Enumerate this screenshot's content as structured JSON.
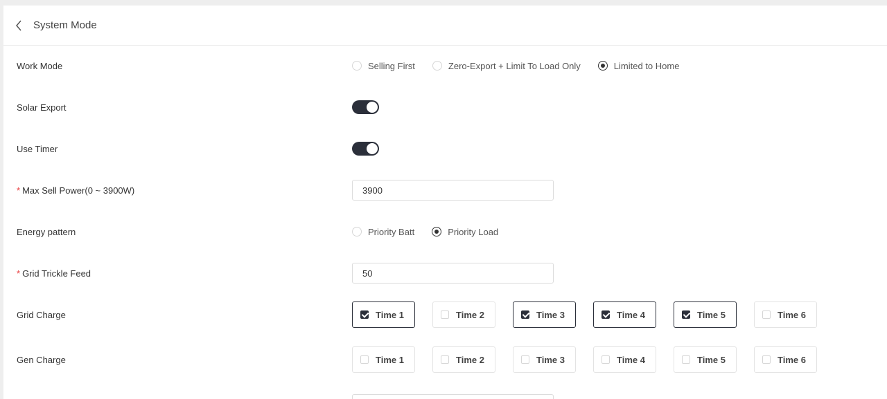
{
  "header": {
    "title": "System Mode"
  },
  "work_mode": {
    "label": "Work Mode",
    "options": [
      {
        "label": "Selling First",
        "selected": false
      },
      {
        "label": "Zero-Export + Limit To Load Only",
        "selected": false
      },
      {
        "label": "Limited to Home",
        "selected": true
      }
    ]
  },
  "solar_export": {
    "label": "Solar Export",
    "on": true
  },
  "use_timer": {
    "label": "Use Timer",
    "on": true
  },
  "max_sell_power": {
    "required_mark": "*",
    "label": "Max Sell Power(0 ~ 3900W)",
    "value": "3900"
  },
  "energy_pattern": {
    "label": "Energy pattern",
    "options": [
      {
        "label": "Priority Batt",
        "selected": false
      },
      {
        "label": "Priority Load",
        "selected": true
      }
    ]
  },
  "grid_trickle_feed": {
    "required_mark": "*",
    "label": "Grid Trickle Feed",
    "value": "50"
  },
  "grid_charge": {
    "label": "Grid Charge",
    "times": [
      {
        "label": "Time 1",
        "checked": true
      },
      {
        "label": "Time 2",
        "checked": false
      },
      {
        "label": "Time 3",
        "checked": true
      },
      {
        "label": "Time 4",
        "checked": true
      },
      {
        "label": "Time 5",
        "checked": true
      },
      {
        "label": "Time 6",
        "checked": false
      }
    ]
  },
  "gen_charge": {
    "label": "Gen Charge",
    "times": [
      {
        "label": "Time 1",
        "checked": false
      },
      {
        "label": "Time 2",
        "checked": false
      },
      {
        "label": "Time 3",
        "checked": false
      },
      {
        "label": "Time 4",
        "checked": false
      },
      {
        "label": "Time 5",
        "checked": false
      },
      {
        "label": "Time 6",
        "checked": false
      }
    ]
  }
}
